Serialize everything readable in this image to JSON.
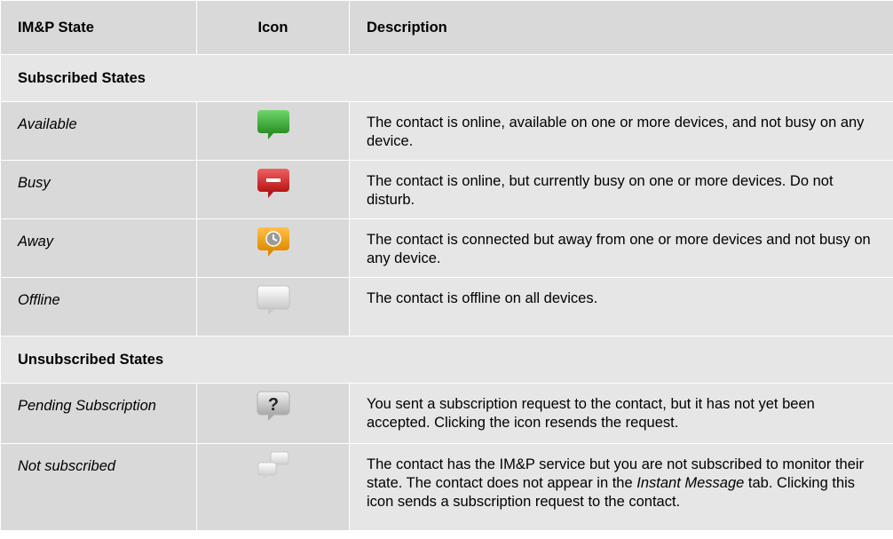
{
  "header": {
    "state": "IM&P State",
    "icon": "Icon",
    "description": "Description"
  },
  "sections": [
    {
      "title": "Subscribed States",
      "rows": [
        {
          "state": "Available",
          "icon": "available-icon",
          "color": "#3aa534",
          "description": "The contact is online, available on one or more devices, and not busy on any device."
        },
        {
          "state": "Busy",
          "icon": "busy-icon",
          "color": "#d42a2a",
          "description": "The contact is online, but currently busy on one or more devices.  Do not disturb."
        },
        {
          "state": "Away",
          "icon": "away-icon",
          "color": "#f0a11a",
          "description": "The contact is connected but away from one or more devices and not busy on any device."
        },
        {
          "state": "Offline",
          "icon": "offline-icon",
          "color": "#cfcfcf",
          "description": "The contact is offline on all devices."
        }
      ]
    },
    {
      "title": "Unsubscribed States",
      "rows": [
        {
          "state": "Pending Subscription",
          "icon": "pending-subscription-icon",
          "color": "#bfbfbf",
          "description": "You sent a subscription request to the contact, but it has not yet been accepted.  Clicking the icon resends the request."
        },
        {
          "state": "Not subscribed",
          "icon": "not-subscribed-icon",
          "color": "#d0d0d0",
          "description_pre": "The contact has the IM&P service but you are not subscribed to monitor their state. The contact does not appear in the ",
          "description_em": "Instant Message",
          "description_post": " tab. Clicking this icon sends a subscription request to the contact."
        }
      ]
    }
  ]
}
